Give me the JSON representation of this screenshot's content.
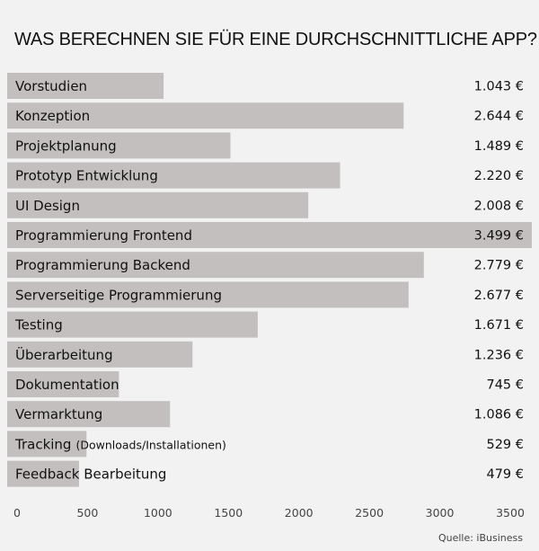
{
  "chart_data": {
    "type": "bar",
    "orientation": "horizontal",
    "title": "WAS BERECHNEN SIE FÜR EINE DURCHSCHNITTLICHE APP?",
    "categories": [
      {
        "main": "Vorstudien",
        "sub": ""
      },
      {
        "main": "Konzeption",
        "sub": ""
      },
      {
        "main": "Projektplanung",
        "sub": ""
      },
      {
        "main": "Prototyp Entwicklung",
        "sub": ""
      },
      {
        "main": "UI Design",
        "sub": ""
      },
      {
        "main": "Programmierung Frontend",
        "sub": ""
      },
      {
        "main": "Programmierung Backend",
        "sub": ""
      },
      {
        "main": "Serverseitige Programmierung",
        "sub": ""
      },
      {
        "main": "Testing",
        "sub": ""
      },
      {
        "main": "Überarbeitung",
        "sub": ""
      },
      {
        "main": "Dokumentation",
        "sub": ""
      },
      {
        "main": "Vermarktung",
        "sub": ""
      },
      {
        "main": "Tracking",
        "sub": "(Downloads/Installationen)"
      },
      {
        "main": "Feedback Bearbeitung",
        "sub": ""
      }
    ],
    "values": [
      1043,
      2644,
      1489,
      2220,
      2008,
      3499,
      2779,
      2677,
      1671,
      1236,
      745,
      1086,
      529,
      479
    ],
    "value_labels": [
      "1.043 €",
      "2.644 €",
      "1.489 €",
      "2.220 €",
      "2.008 €",
      "3.499 €",
      "2.779 €",
      "2.677 €",
      "1.671 €",
      "1.236 €",
      "745 €",
      "1.086 €",
      "529 €",
      "479 €"
    ],
    "xticks": [
      0,
      500,
      1000,
      1500,
      2000,
      2500,
      3000,
      3500
    ],
    "xlim": [
      0,
      3500
    ],
    "xlabel": "",
    "ylabel": "",
    "unit": "€",
    "grid": false,
    "legend": "none",
    "bar_color": "#c3bfbf",
    "source": "Quelle: iBusiness"
  }
}
